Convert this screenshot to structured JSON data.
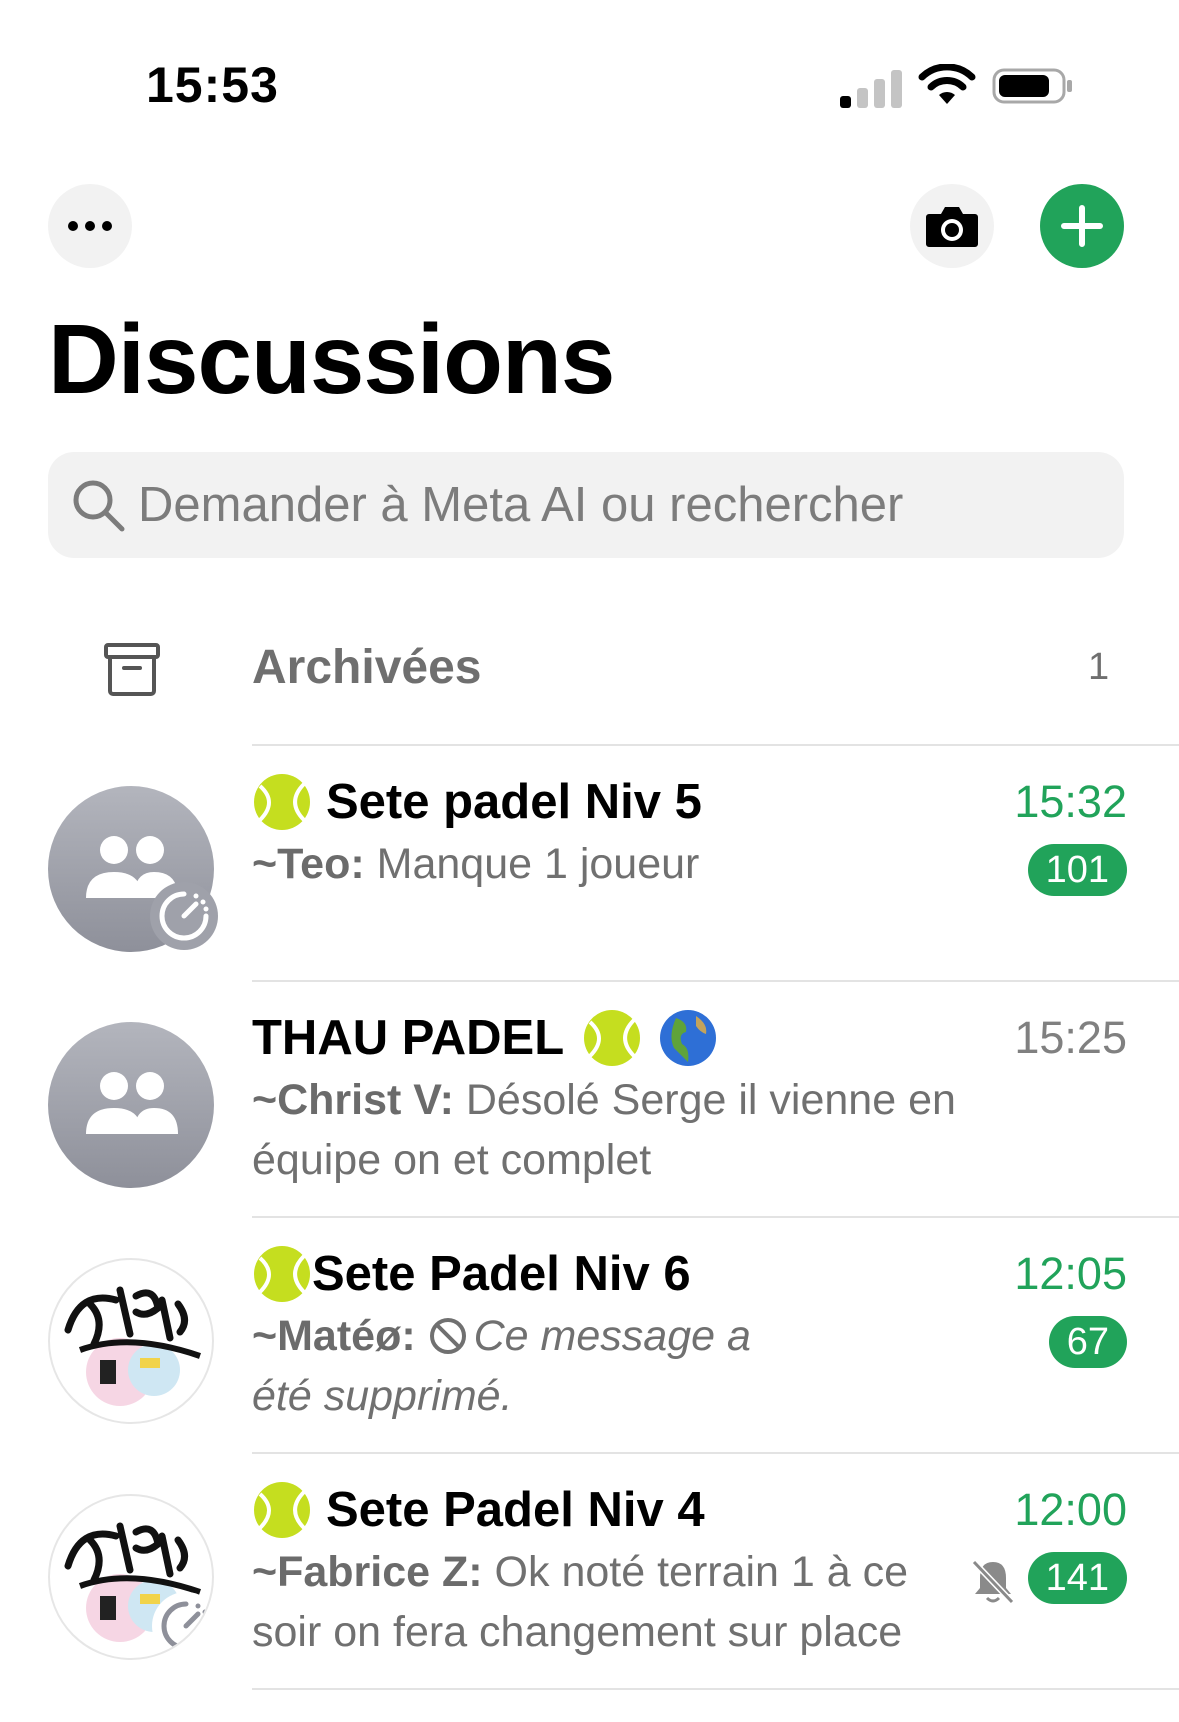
{
  "status_bar": {
    "time": "15:53"
  },
  "page": {
    "title": "Discussions"
  },
  "search": {
    "placeholder": "Demander à Meta AI ou rechercher"
  },
  "archived": {
    "label": "Archivées",
    "count": "1"
  },
  "colors": {
    "accent": "#21a35a",
    "secondary_text": "#707070",
    "search_bg": "#f2f2f2"
  },
  "chats": [
    {
      "name": "Sete padel Niv 5",
      "emoji": "tennis-ball",
      "time": "15:32",
      "sender": "~Teo:",
      "message": " Manque 1 joueur",
      "unread": "101",
      "avatar": "group-icon"
    },
    {
      "name": "THAU PADEL",
      "emoji": "tennis-ball globe",
      "time": "15:25",
      "sender": "~Christ V:",
      "message": " Désolé Serge il vienne en équipe on et complet",
      "avatar": "group-icon"
    },
    {
      "name": "Sete Padel Niv 6",
      "emoji": "tennis-ball",
      "time": "12:05",
      "sender": "~Matéø:",
      "message": "Ce message a été supprimé.",
      "unread": "67",
      "avatar": "club-logo"
    },
    {
      "name": "Sete Padel Niv 4",
      "emoji": "tennis-ball",
      "time": "12:00",
      "sender": "~Fabrice Z:",
      "message": " Ok noté terrain 1 à ce soir on fera changement sur place",
      "unread": "141",
      "avatar": "club-logo",
      "muted": "true"
    }
  ]
}
